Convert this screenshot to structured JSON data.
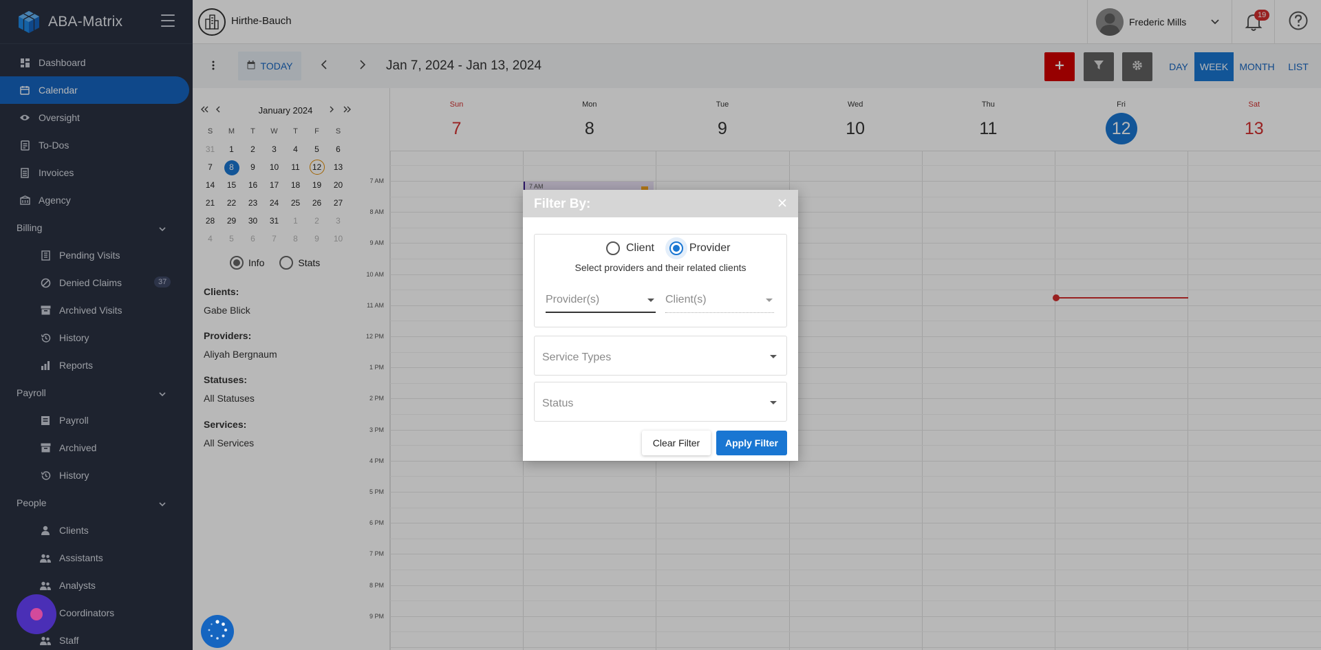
{
  "sidebar": {
    "brand": "ABA-Matrix",
    "items": [
      {
        "label": "Dashboard",
        "icon": "dashboard-icon"
      },
      {
        "label": "Calendar",
        "icon": "calendar-icon",
        "active": true
      },
      {
        "label": "Oversight",
        "icon": "eye-icon"
      },
      {
        "label": "To-Dos",
        "icon": "todo-icon"
      },
      {
        "label": "Invoices",
        "icon": "invoice-icon"
      },
      {
        "label": "Agency",
        "icon": "agency-icon"
      }
    ],
    "billing": {
      "label": "Billing",
      "items": [
        {
          "label": "Pending Visits",
          "icon": "building-icon"
        },
        {
          "label": "Denied Claims",
          "icon": "block-icon",
          "badge": "37"
        },
        {
          "label": "Archived Visits",
          "icon": "archive-icon"
        },
        {
          "label": "History",
          "icon": "history-icon"
        },
        {
          "label": "Reports",
          "icon": "chart-icon"
        }
      ]
    },
    "payroll": {
      "label": "Payroll",
      "items": [
        {
          "label": "Payroll",
          "icon": "payroll-icon"
        },
        {
          "label": "Archived",
          "icon": "archive-icon"
        },
        {
          "label": "History",
          "icon": "history-icon"
        }
      ]
    },
    "people": {
      "label": "People",
      "items": [
        {
          "label": "Clients",
          "icon": "person-icon"
        },
        {
          "label": "Assistants",
          "icon": "group-icon"
        },
        {
          "label": "Analysts",
          "icon": "group-icon"
        },
        {
          "label": "Coordinators",
          "icon": "group-icon"
        },
        {
          "label": "Staff",
          "icon": "group-icon"
        }
      ]
    }
  },
  "header": {
    "org_name": "Hirthe-Bauch",
    "user_name": "Frederic Mills",
    "notification_count": "19"
  },
  "toolbar": {
    "today_label": "TODAY",
    "range_title": "Jan 7, 2024 - Jan 13, 2024",
    "views": [
      "DAY",
      "WEEK",
      "MONTH",
      "LIST"
    ],
    "active_view": "WEEK"
  },
  "mini_calendar": {
    "title": "January 2024",
    "dow": [
      "S",
      "M",
      "T",
      "W",
      "T",
      "F",
      "S"
    ],
    "weeks": [
      [
        "31",
        "1",
        "2",
        "3",
        "4",
        "5",
        "6"
      ],
      [
        "7",
        "8",
        "9",
        "10",
        "11",
        "12",
        "13"
      ],
      [
        "14",
        "15",
        "16",
        "17",
        "18",
        "19",
        "20"
      ],
      [
        "21",
        "22",
        "23",
        "24",
        "25",
        "26",
        "27"
      ],
      [
        "28",
        "29",
        "30",
        "31",
        "1",
        "2",
        "3"
      ],
      [
        "4",
        "5",
        "6",
        "7",
        "8",
        "9",
        "10"
      ]
    ],
    "selected_day": "8",
    "today_day": "12"
  },
  "panel_mode": {
    "info_label": "Info",
    "stats_label": "Stats",
    "selected": "Info"
  },
  "info": {
    "clients_label": "Clients:",
    "clients_value": "Gabe Blick",
    "providers_label": "Providers:",
    "providers_value": "Aliyah Bergnaum",
    "statuses_label": "Statuses:",
    "statuses_value": "All Statuses",
    "services_label": "Services:",
    "services_value": "All Services"
  },
  "week": {
    "days": [
      {
        "dow": "Sun",
        "num": "7",
        "weekend": true
      },
      {
        "dow": "Mon",
        "num": "8"
      },
      {
        "dow": "Tue",
        "num": "9"
      },
      {
        "dow": "Wed",
        "num": "10"
      },
      {
        "dow": "Thu",
        "num": "11"
      },
      {
        "dow": "Fri",
        "num": "12",
        "today": true
      },
      {
        "dow": "Sat",
        "num": "13",
        "weekend": true
      }
    ],
    "times": [
      "7 AM",
      "8 AM",
      "9 AM",
      "10 AM",
      "11 AM",
      "12 PM",
      "1 PM",
      "2 PM",
      "3 PM",
      "4 PM",
      "5 PM",
      "6 PM",
      "7 PM",
      "8 PM",
      "9 PM"
    ],
    "event_label": "7 AM"
  },
  "modal": {
    "title": "Filter By:",
    "client_option": "Client",
    "provider_option": "Provider",
    "selected_option": "Provider",
    "helper_text": "Select providers and their related clients",
    "provider_placeholder": "Provider(s)",
    "client_placeholder": "Client(s)",
    "service_types_placeholder": "Service Types",
    "status_placeholder": "Status",
    "clear_label": "Clear Filter",
    "apply_label": "Apply Filter"
  },
  "colors": {
    "sidebar_bg": "#2a3142",
    "accent": "#1976d2",
    "danger": "#d20000",
    "weekend": "#d32f2f"
  }
}
